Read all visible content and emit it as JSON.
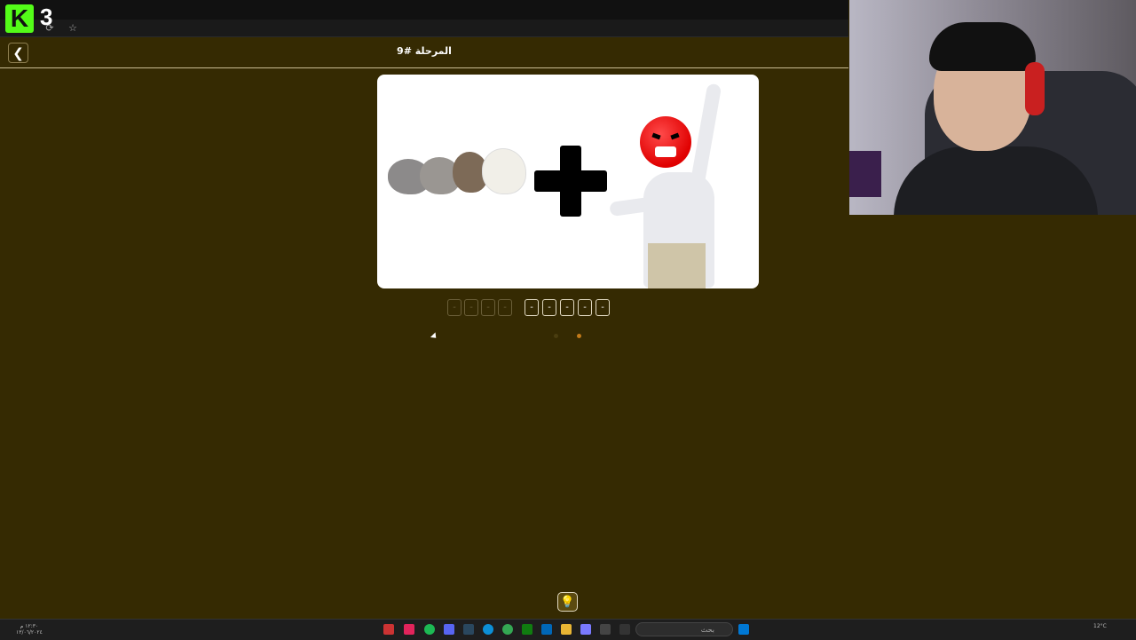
{
  "overlay": {
    "viewer_count": "3",
    "logo_letter": "K"
  },
  "browser": {
    "icons": [
      "reload-icon",
      "star-icon"
    ],
    "reload_glyph": "⟳",
    "star_glyph": "☆"
  },
  "header": {
    "back_glyph": "❮",
    "level_title": "المرحلة #9"
  },
  "answer": {
    "word1": [
      "-",
      "-",
      "-",
      "-"
    ],
    "word2": [
      "-",
      "-",
      "-",
      "-",
      "-"
    ]
  },
  "hint": {
    "glyph": "💡"
  },
  "taskbar": {
    "search_placeholder": "بحث",
    "tray_time": "١٢:٣٠ م",
    "tray_date": "١٣/٠٦/٢٠٢٤",
    "weather": "12°C"
  },
  "colors": {
    "background": "#352a02",
    "slot_border": "#e0d8c0",
    "accent_dot": "#c27a1a"
  }
}
